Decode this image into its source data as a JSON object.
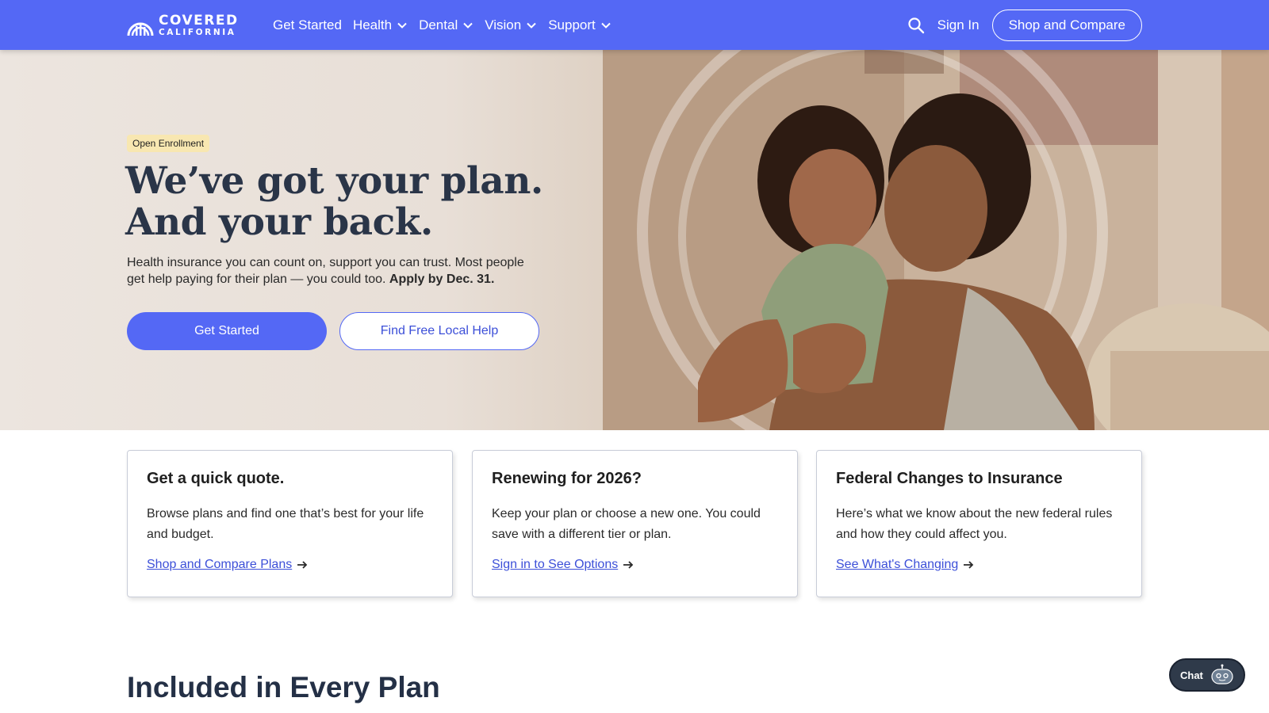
{
  "nav": {
    "logo_line1": "COVERED",
    "logo_line2": "CALIFORNIA",
    "menu": [
      {
        "label": "Get Started",
        "has_dropdown": false
      },
      {
        "label": "Health",
        "has_dropdown": true
      },
      {
        "label": "Dental",
        "has_dropdown": true
      },
      {
        "label": "Vision",
        "has_dropdown": true
      },
      {
        "label": "Support",
        "has_dropdown": true
      }
    ],
    "sign_in": "Sign In",
    "shop_compare": "Shop and Compare"
  },
  "hero": {
    "badge": "Open Enrollment",
    "title_line1": "We’ve got your plan.",
    "title_line2": "And your back.",
    "subtitle": "Health insurance you can count on, support you can trust. Most people get help paying for their plan — you could too.",
    "subtitle_bold": "Apply by Dec. 31.",
    "primary_button": "Get Started",
    "secondary_button": "Find Free Local Help"
  },
  "cards": [
    {
      "title": "Get a quick quote.",
      "body": "Browse plans and find one that’s best for your life and budget.",
      "link": "Shop and Compare Plans"
    },
    {
      "title": "Renewing for 2026?",
      "body": "Keep your plan or choose a new one. You could save with a different tier or plan.",
      "link": "Sign in to See Options"
    },
    {
      "title": "Federal Changes to Insurance",
      "body": "Here’s what we know about the new federal rules and how they could affect you.",
      "link": "See What's Changing"
    }
  ],
  "section_title": "Included in Every Plan",
  "chat_label": "Chat",
  "colors": {
    "brand": "#5468f5",
    "badge": "#f8e7b1",
    "heading": "#2a3548"
  }
}
